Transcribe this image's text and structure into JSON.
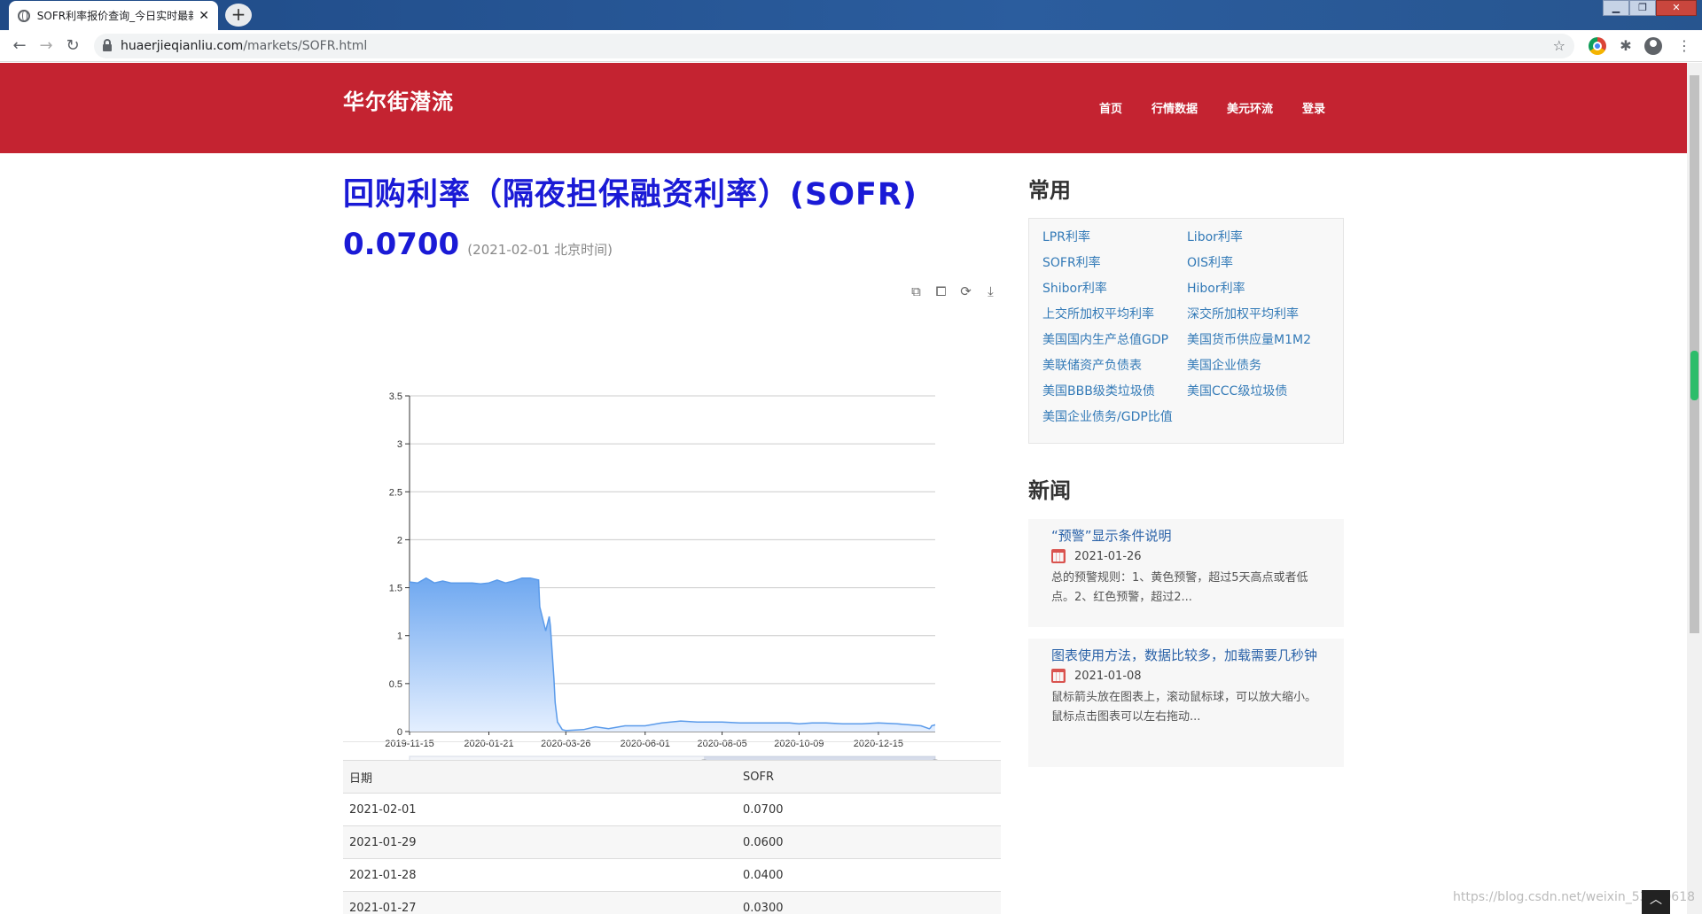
{
  "browser": {
    "tab_title": "SOFR利率报价查询_今日实时最新",
    "tab_close": "✕",
    "new_tab": "+",
    "url_host": "huaerjieqianliu.com",
    "url_path": "/markets/SOFR.html"
  },
  "site": {
    "logo": "华尔街潜流",
    "nav": [
      "首页",
      "行情数据",
      "美元环流",
      "登录"
    ]
  },
  "main": {
    "title": "回购利率（隔夜担保融资利率）(SOFR)",
    "rate": "0.0700",
    "rate_date": "(2021-02-01 北京时间)"
  },
  "chart_data": {
    "type": "area",
    "x_ticks": [
      "2019-11-15",
      "2020-01-21",
      "2020-03-26",
      "2020-06-01",
      "2020-08-05",
      "2020-10-09",
      "2020-12-15"
    ],
    "ylim": [
      0,
      3.5
    ],
    "y_ticks": [
      "0",
      "0.5",
      "1",
      "1.5",
      "2",
      "2.5",
      "3",
      "3.5"
    ],
    "grid": true,
    "color": "#5b9bea",
    "x_start": "2019-11-15",
    "x_end": "2021-02-01",
    "series": [
      {
        "values": [
          [
            "2019-11-15",
            1.56
          ],
          [
            "2019-11-22",
            1.55
          ],
          [
            "2019-11-29",
            1.6
          ],
          [
            "2019-12-06",
            1.55
          ],
          [
            "2019-12-13",
            1.57
          ],
          [
            "2019-12-20",
            1.55
          ],
          [
            "2019-12-31",
            1.55
          ],
          [
            "2020-01-07",
            1.55
          ],
          [
            "2020-01-14",
            1.54
          ],
          [
            "2020-01-21",
            1.55
          ],
          [
            "2020-01-28",
            1.58
          ],
          [
            "2020-02-04",
            1.55
          ],
          [
            "2020-02-11",
            1.57
          ],
          [
            "2020-02-18",
            1.6
          ],
          [
            "2020-02-25",
            1.6
          ],
          [
            "2020-03-03",
            1.58
          ],
          [
            "2020-03-04",
            1.3
          ],
          [
            "2020-03-09",
            1.05
          ],
          [
            "2020-03-12",
            1.2
          ],
          [
            "2020-03-13",
            1.1
          ],
          [
            "2020-03-16",
            0.55
          ],
          [
            "2020-03-17",
            0.3
          ],
          [
            "2020-03-19",
            0.1
          ],
          [
            "2020-03-23",
            0.02
          ],
          [
            "2020-03-26",
            0.01
          ],
          [
            "2020-04-10",
            0.02
          ],
          [
            "2020-04-20",
            0.05
          ],
          [
            "2020-05-01",
            0.03
          ],
          [
            "2020-05-15",
            0.06
          ],
          [
            "2020-06-01",
            0.06
          ],
          [
            "2020-06-15",
            0.09
          ],
          [
            "2020-07-01",
            0.11
          ],
          [
            "2020-07-15",
            0.1
          ],
          [
            "2020-08-01",
            0.1
          ],
          [
            "2020-08-05",
            0.1
          ],
          [
            "2020-08-20",
            0.09
          ],
          [
            "2020-09-01",
            0.09
          ],
          [
            "2020-09-15",
            0.09
          ],
          [
            "2020-10-01",
            0.09
          ],
          [
            "2020-10-09",
            0.08
          ],
          [
            "2020-10-20",
            0.09
          ],
          [
            "2020-11-01",
            0.09
          ],
          [
            "2020-11-15",
            0.08
          ],
          [
            "2020-12-01",
            0.08
          ],
          [
            "2020-12-15",
            0.09
          ],
          [
            "2020-12-31",
            0.08
          ],
          [
            "2021-01-10",
            0.07
          ],
          [
            "2021-01-20",
            0.06
          ],
          [
            "2021-01-27",
            0.03
          ],
          [
            "2021-01-28",
            0.04
          ],
          [
            "2021-01-29",
            0.06
          ],
          [
            "2021-02-01",
            0.07
          ]
        ]
      }
    ],
    "datazoom_range": [
      0.56,
      1.0
    ]
  },
  "table": {
    "headers": [
      "日期",
      "SOFR"
    ],
    "rows": [
      [
        "2021-02-01",
        "0.0700"
      ],
      [
        "2021-01-29",
        "0.0600"
      ],
      [
        "2021-01-28",
        "0.0400"
      ],
      [
        "2021-01-27",
        "0.0300"
      ]
    ]
  },
  "sidebar": {
    "common_title": "常用",
    "links": [
      "LPR利率",
      "Libor利率",
      "SOFR利率",
      "OIS利率",
      "Shibor利率",
      "Hibor利率",
      "上交所加权平均利率",
      "深交所加权平均利率",
      "美国国内生产总值GDP",
      "美国货币供应量M1M2",
      "美联储资产负债表",
      "美国企业债务",
      "美国BBB级类垃圾债",
      "美国CCC级垃圾债",
      "美国企业债务/GDP比值"
    ],
    "news_title": "新闻",
    "news": [
      {
        "title": "“预警”显示条件说明",
        "date": "2021-01-26",
        "desc": "总的预警规则：1、黄色预警，超过5天高点或者低点。2、红色预警，超过2..."
      },
      {
        "title": "图表使用方法，数据比较多，加载需要几秒钟",
        "date": "2021-01-08",
        "desc": "鼠标箭头放在图表上，滚动鼠标球，可以放大缩小。鼠标点击图表可以左右拖动..."
      }
    ]
  },
  "watermark": "https://blog.csdn.net/weixin_53100618",
  "back_top": "︿"
}
